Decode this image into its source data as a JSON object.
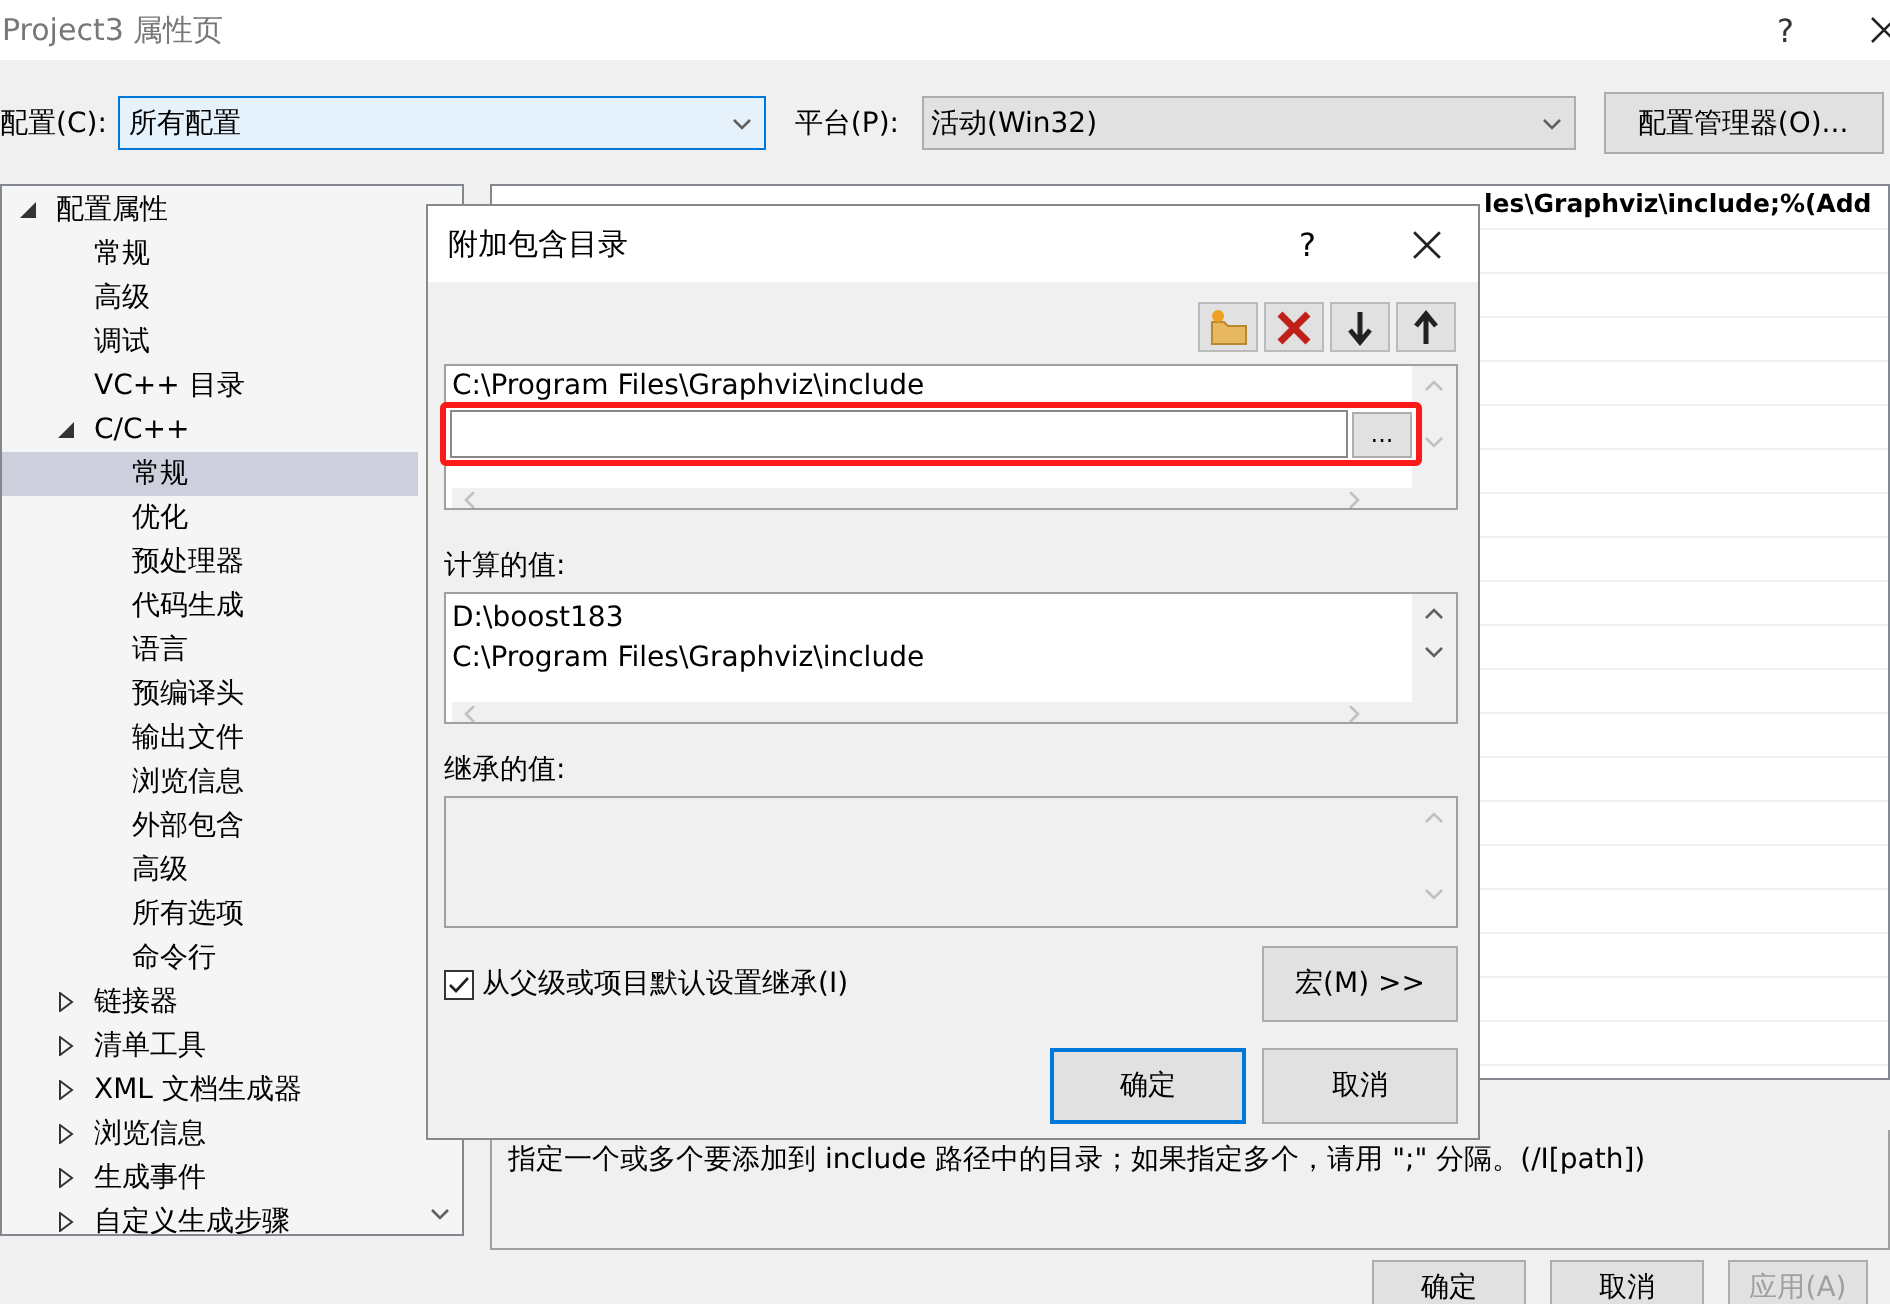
{
  "window": {
    "title": "Project3 属性页",
    "help": "?"
  },
  "toolbar": {
    "config_label": "配置(C):",
    "config_value": "所有配置",
    "platform_label": "平台(P):",
    "platform_value": "活动(Win32)",
    "manager_button": "配置管理器(O)..."
  },
  "tree": [
    {
      "label": "配置属性",
      "expanded": true,
      "selected": false,
      "children": [
        {
          "label": "常规",
          "selected": false
        },
        {
          "label": "高级",
          "selected": false
        },
        {
          "label": "调试",
          "selected": false
        },
        {
          "label": "VC++ 目录",
          "selected": false
        },
        {
          "label": "C/C++",
          "expanded": true,
          "selected": false,
          "children": [
            {
              "label": "常规",
              "selected": true
            },
            {
              "label": "优化",
              "selected": false
            },
            {
              "label": "预处理器",
              "selected": false
            },
            {
              "label": "代码生成",
              "selected": false
            },
            {
              "label": "语言",
              "selected": false
            },
            {
              "label": "预编译头",
              "selected": false
            },
            {
              "label": "输出文件",
              "selected": false
            },
            {
              "label": "浏览信息",
              "selected": false
            },
            {
              "label": "外部包含",
              "selected": false
            },
            {
              "label": "高级",
              "selected": false
            },
            {
              "label": "所有选项",
              "selected": false
            },
            {
              "label": "命令行",
              "selected": false
            }
          ]
        },
        {
          "label": "链接器",
          "expanded": false,
          "selected": false
        },
        {
          "label": "清单工具",
          "expanded": false,
          "selected": false
        },
        {
          "label": "XML 文档生成器",
          "expanded": false,
          "selected": false
        },
        {
          "label": "浏览信息",
          "expanded": false,
          "selected": false
        },
        {
          "label": "生成事件",
          "expanded": false,
          "selected": false
        },
        {
          "label": "自定义生成步骤",
          "expanded": false,
          "selected": false
        }
      ]
    }
  ],
  "grid": {
    "rows": [
      {
        "value": "les\\Graphviz\\include;%(Add"
      }
    ]
  },
  "description": "指定一个或多个要添加到 include 路径中的目录；如果指定多个，请用 \";\" 分隔。(/I[path])",
  "buttons": [
    {
      "label": "确定",
      "disabled": false
    },
    {
      "label": "取消",
      "disabled": false
    },
    {
      "label": "应用(A)",
      "disabled": true
    }
  ],
  "dialog": {
    "title": "附加包含目录",
    "help": "?",
    "entries": [
      "C:\\Program Files\\Graphviz\\include"
    ],
    "edit_highlighted": true,
    "browse_button": "...",
    "computed_label": "计算的值:",
    "computed_values": [
      "D:\\boost183",
      "C:\\Program Files\\Graphviz\\include"
    ],
    "inherited_label": "继承的值:",
    "inherit": {
      "label": "从父级或项目默认设置继承(I)",
      "checked": true
    },
    "macro_button": "宏(M) >>",
    "buttons": [
      {
        "label": "确定",
        "default": true
      },
      {
        "label": "取消",
        "default": false
      }
    ]
  }
}
